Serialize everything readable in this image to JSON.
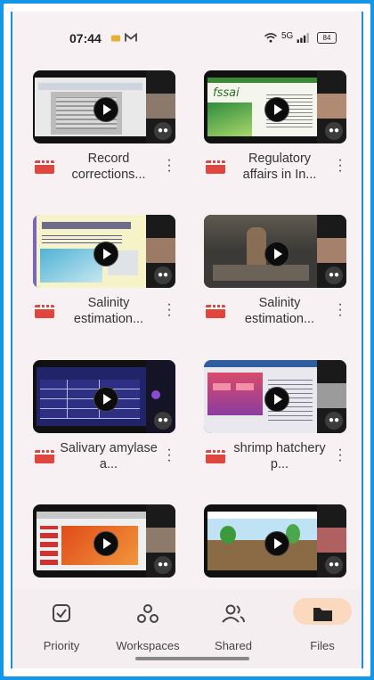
{
  "status_bar": {
    "time": "07:44",
    "battery": "84",
    "signal_text": "5G"
  },
  "videos": [
    {
      "title": "Record corrections..."
    },
    {
      "title": "Regulatory affairs in In..."
    },
    {
      "title": "Salinity estimation..."
    },
    {
      "title": "Salinity estimation..."
    },
    {
      "title": "Salivary amylase a..."
    },
    {
      "title": "shrimp hatchery p..."
    },
    {
      "title": ""
    },
    {
      "title": ""
    }
  ],
  "nav": {
    "priority": "Priority",
    "workspaces": "Workspaces",
    "shared": "Shared",
    "files": "Files"
  },
  "colors": {
    "accent_pill": "#fbd9be",
    "video_icon": "#e0453e",
    "outer_border": "#1596e6"
  }
}
